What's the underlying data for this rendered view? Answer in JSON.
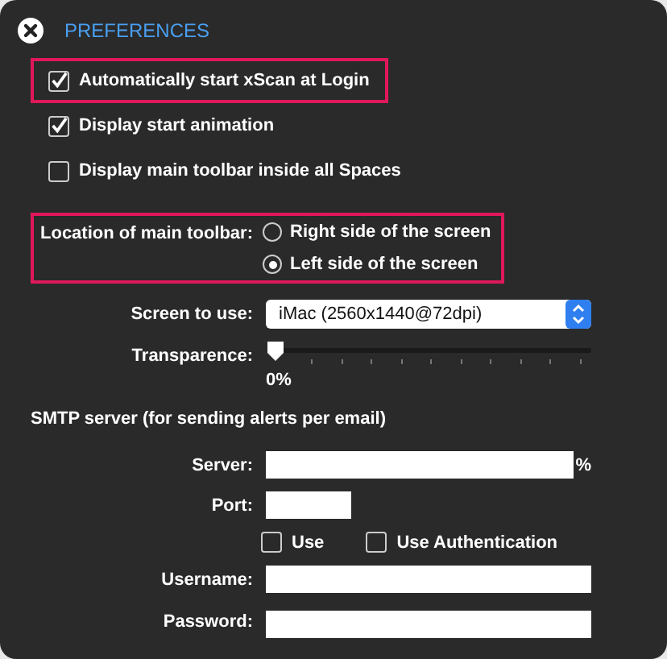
{
  "window": {
    "title": "PREFERENCES"
  },
  "options": [
    {
      "label": "Automatically start xScan at Login",
      "checked": true,
      "highlighted": true
    },
    {
      "label": "Display start animation",
      "checked": true,
      "highlighted": false
    },
    {
      "label": "Display main toolbar inside all Spaces",
      "checked": false,
      "highlighted": false
    }
  ],
  "toolbar_location": {
    "label": "Location of main toolbar:",
    "highlighted": true,
    "choices": [
      {
        "label": "Right side of the screen",
        "selected": false
      },
      {
        "label": "Left side of the screen",
        "selected": true
      }
    ]
  },
  "screen": {
    "label": "Screen to use:",
    "value": "iMac (2560x1440@72dpi)"
  },
  "transparence": {
    "label": "Transparence:",
    "level": 0,
    "reading": "0%"
  },
  "smtp": {
    "heading": "SMTP server (for sending alerts per email)",
    "server_label": "Server:",
    "server_suffix": "%",
    "port_label": "Port:",
    "flags": [
      {
        "label": "Use",
        "checked": false
      },
      {
        "label": "Use Authentication",
        "checked": false
      }
    ],
    "username_label": "Username:",
    "password_label": "Password:"
  }
}
